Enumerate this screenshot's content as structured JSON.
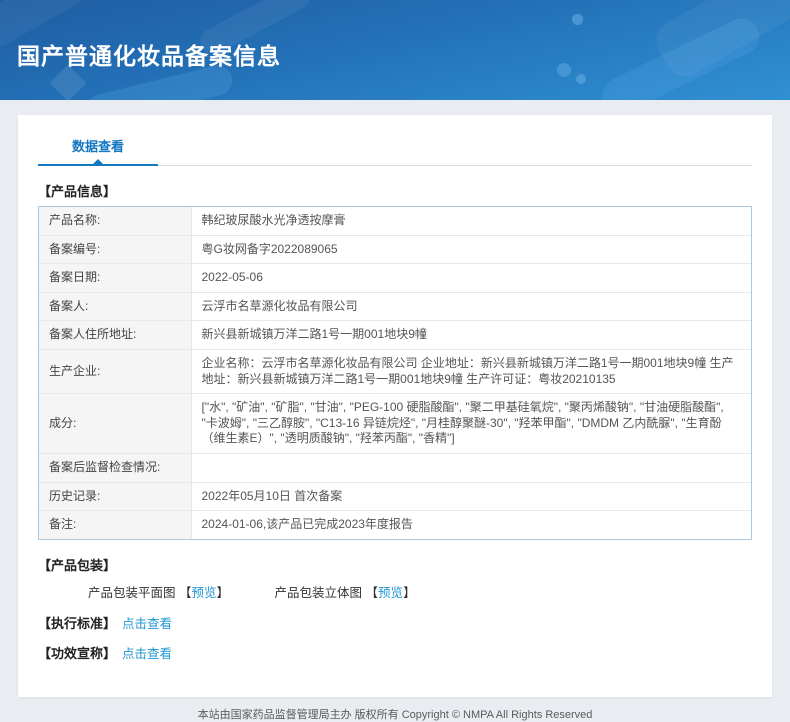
{
  "colors": {
    "accent_blue": "#1478c0",
    "link_blue": "#2196d3",
    "header_gradient_top": "#1f5da3",
    "header_gradient_bottom": "#3190d3",
    "page_background": "#e9edf2",
    "table_border": "#aac8e2",
    "label_cell_background": "#f5f5f5"
  },
  "header": {
    "title": "国产普通化妆品备案信息"
  },
  "tabs": {
    "data_view": "数据查看"
  },
  "product_info": {
    "section_title": "【产品信息】",
    "rows": [
      {
        "label": "产品名称:",
        "value": "韩纪玻尿酸水光净透按摩膏"
      },
      {
        "label": "备案编号:",
        "value": "粤G妆网备字2022089065"
      },
      {
        "label": "备案日期:",
        "value": "2022-05-06"
      },
      {
        "label": "备案人:",
        "value": "云浮市名草源化妆品有限公司"
      },
      {
        "label": "备案人住所地址:",
        "value": "新兴县新城镇万洋二路1号一期001地块9幢"
      },
      {
        "label": "生产企业:",
        "value": "企业名称：云浮市名草源化妆品有限公司 企业地址：新兴县新城镇万洋二路1号一期001地块9幢 生产地址：新兴县新城镇万洋二路1号一期001地块9幢 生产许可证：粤妆20210135"
      },
      {
        "label": "成分:",
        "value": "[\"水\", \"矿油\", \"矿脂\", \"甘油\", \"PEG-100 硬脂酸酯\", \"聚二甲基硅氧烷\", \"聚丙烯酸钠\", \"甘油硬脂酸酯\", \"卡波姆\", \"三乙醇胺\", \"C13-16 异链烷烃\", \"月桂醇聚醚-30\", \"羟苯甲酯\", \"DMDM 乙内酰脲\", \"生育酚（维生素E）\", \"透明质酸钠\", \"羟苯丙酯\", \"香精\"]"
      },
      {
        "label": "备案后监督检查情况:",
        "value": ""
      },
      {
        "label": "历史记录:",
        "value": "2022年05月10日 首次备案"
      },
      {
        "label": "备注:",
        "value": "2024-01-06,该产品已完成2023年度报告"
      }
    ]
  },
  "packaging": {
    "section_title": "【产品包装】",
    "bracket_open": "【",
    "bracket_close": "】",
    "items": [
      {
        "label": "产品包装平面图",
        "link": "预览"
      },
      {
        "label": "产品包装立体图",
        "link": "预览"
      }
    ]
  },
  "standard": {
    "section_title": "【执行标准】",
    "link": "点击查看"
  },
  "efficacy": {
    "section_title": "【功效宣称】",
    "link": "点击查看"
  },
  "footer": {
    "text": "本站由国家药品监督管理局主办 版权所有 Copyright © NMPA All Rights Reserved"
  }
}
